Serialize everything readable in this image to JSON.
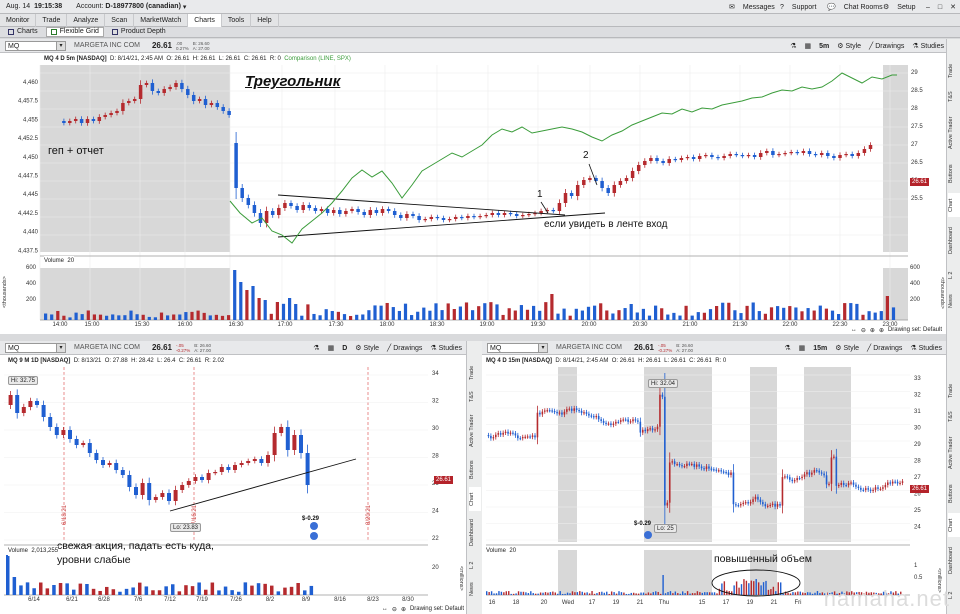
{
  "topbar": {
    "date": "Aug. 14",
    "time": "19:15:38",
    "account_label": "Account:",
    "account": "D-18977800 (canadian)",
    "messages": "Messages",
    "support": "Support",
    "chat": "Chat Rooms",
    "setup": "Setup"
  },
  "menu": [
    "Monitor",
    "Trade",
    "Analyze",
    "Scan",
    "MarketWatch",
    "Charts",
    "Tools",
    "Help"
  ],
  "menu_active": "Charts",
  "subtabs": [
    "Charts",
    "Flexible Grid",
    "Product Depth"
  ],
  "main": {
    "symbol": "MQ",
    "company": "MARGETA INC COM",
    "price": "26.61",
    "chg_pct": ".00",
    "chg_pct2": "0.27%",
    "bid": "B: 26.60",
    "ask": "A: 27.00",
    "timeframe": "5m",
    "style": "Style",
    "drawings": "Drawings",
    "studies": "Studies",
    "info": "MQ 4 D 5m [NASDAQ]",
    "date": "D: 8/14/21, 2:45 AM",
    "open": "O: 26.61",
    "high": "H: 26.61",
    "low": "L: 26.61",
    "close": "C: 26.61",
    "range": "R: 0",
    "comparison": "Comparison (LINE, SPX)",
    "left_axis": [
      "4,460",
      "4,457.5",
      "4,455",
      "4,452.5",
      "4,450",
      "4,447.5",
      "4,445",
      "4,442.5",
      "4,440",
      "4,437.5"
    ],
    "right_axis": [
      "29",
      "28.5",
      "28",
      "27.5",
      "27",
      "26.5",
      "26",
      "25.5"
    ],
    "x_labels": [
      "14:00",
      "15:00",
      "15:30",
      "16:00",
      "16:30",
      "17:00",
      "17:30",
      "18:00",
      "18:30",
      "19:00",
      "19:30",
      "20:00",
      "20:30",
      "21:00",
      "21:30",
      "22:00",
      "22:30",
      "23:00"
    ],
    "price_tag": "26.61",
    "volume_label": "Volume",
    "volume_val": "20",
    "vol_axis": [
      "600",
      "400",
      "200"
    ],
    "vol_unit": "<thousands>",
    "drawing_set": "Drawing set: Default",
    "ann_title": "Треугольник",
    "ann_gap": "геп + отчет",
    "ann_1": "1",
    "ann_2": "2",
    "ann_entry": "если увидеть в ленте вход"
  },
  "left": {
    "symbol": "MQ",
    "company": "MARGETA INC COM",
    "price": "26.61",
    "chg": "-.05",
    "chg2": "-0.27%",
    "bid": "B: 26.60",
    "ask": "A: 27.00",
    "timeframe": "D",
    "style": "Style",
    "drawings": "Drawings",
    "studies": "Studies",
    "info": "MQ 9 M 1D [NASDAQ]",
    "date": "D: 8/13/21",
    "open": "O: 27.88",
    "high": "H: 28.42",
    "low": "L: 26.4",
    "close": "C: 26.61",
    "range": "R: 2.02",
    "hi_tag": "Hi: 32.75",
    "lo_tag": "Lo: 23.83",
    "price_tag": "26.61",
    "earn": "$-0.29",
    "y_axis": [
      "34",
      "32",
      "30",
      "28",
      "26",
      "24",
      "22"
    ],
    "x_labels": [
      "6/14",
      "6/21",
      "6/28",
      "7/6",
      "7/12",
      "7/19",
      "7/26",
      "8/2",
      "8/9",
      "8/16",
      "8/23",
      "8/30"
    ],
    "vert_labels": [
      "6/18/21",
      "7/16/21",
      "8/20/21"
    ],
    "volume_label": "Volume",
    "volume_val": "2,013,255",
    "vol_axis": [
      "20"
    ],
    "vol_unit": "<millions>",
    "drawing_set": "Drawing set: Default",
    "ann": "свежая акция, падать есть куда, уровни слабые"
  },
  "right": {
    "symbol": "MQ",
    "company": "MARGETA INC COM",
    "price": "26.61",
    "chg": "-.05",
    "chg2": "-0.27%",
    "bid": "B: 26.60",
    "ask": "A: 27.00",
    "timeframe": "15m",
    "style": "Style",
    "drawings": "Drawings",
    "studies": "Studies",
    "info": "MQ 4 D 15m [NASDAQ]",
    "date": "D: 8/14/21, 2:45 AM",
    "open": "O: 26.61",
    "high": "H: 26.61",
    "low": "L: 26.61",
    "close": "C: 26.61",
    "range": "R: 0",
    "hi_tag": "Hi: 32.04",
    "lo_tag": "Lo: 25",
    "price_tag": "26.61",
    "earn": "$-0.29",
    "y_axis": [
      "33",
      "32",
      "31",
      "30",
      "29",
      "28",
      "27",
      "26",
      "25",
      "24"
    ],
    "x_labels": [
      "16",
      "18",
      "20",
      "Wed",
      "17",
      "19",
      "21",
      "Thu",
      "15",
      "17",
      "19",
      "21",
      "Fri"
    ],
    "volume_label": "Volume",
    "volume_val": "20",
    "vol_axis": [
      "1",
      "0.5"
    ],
    "vol_unit": "<millions>",
    "drawing_set": "Drawing set: Default",
    "ann": "повышенный объем"
  },
  "side_tabs": [
    "Trade",
    "T&S",
    "Active Trader",
    "Buttons",
    "Chart",
    "Dashboard",
    "L 2",
    "News"
  ],
  "watermark": "hamaha.net",
  "colors": {
    "up": "#1f5fd1",
    "down": "#b52a2e",
    "spx": "#3a9c3a"
  }
}
